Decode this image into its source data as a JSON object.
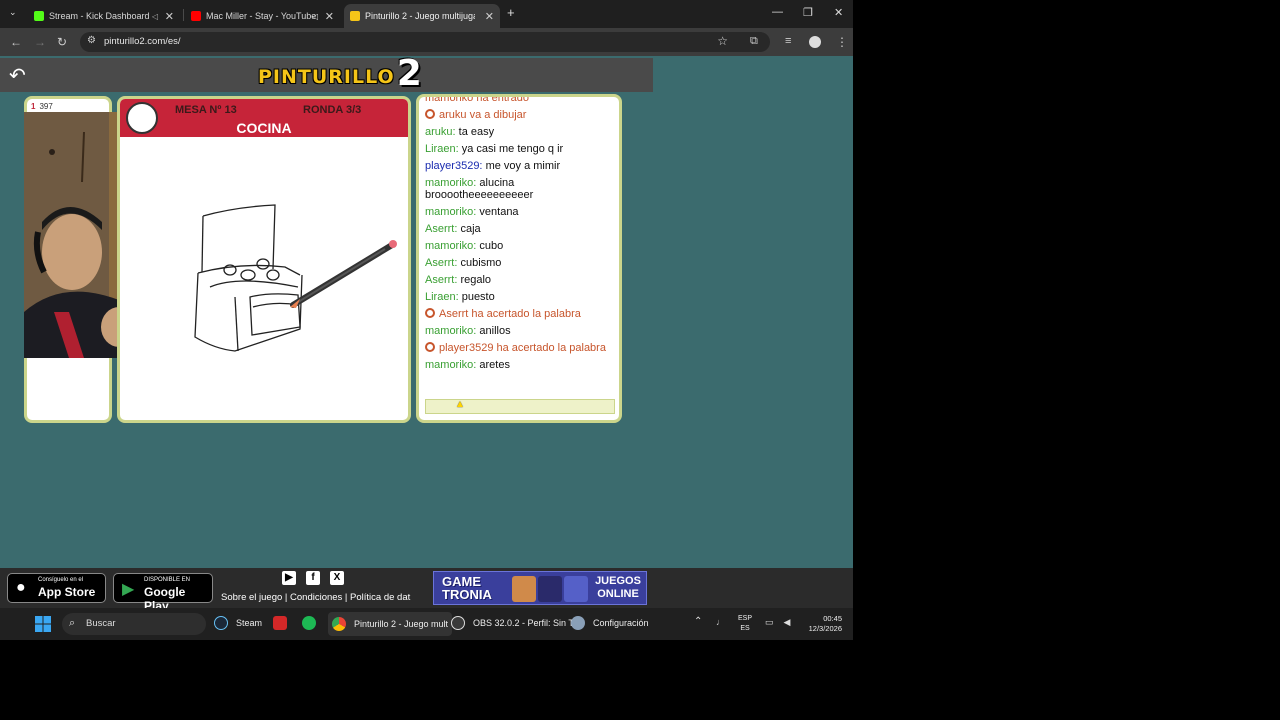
{
  "browser": {
    "tabs": [
      {
        "title": "Stream - Kick Dashboard",
        "favicon_color": "#53fc18",
        "active": false
      },
      {
        "title": "Mac Miller - Stay - YouTube",
        "favicon_color": "#ff0000",
        "active": false
      },
      {
        "title": "Pinturillo 2 - Juego multijugad",
        "favicon_color": "#f5c518",
        "active": true
      }
    ],
    "new_tab": "+",
    "url": "pinturillo2.com/es/"
  },
  "game": {
    "logo_text": "PINTURILLO",
    "logo_number": "2",
    "player_score": "397",
    "player_rank": "1",
    "mesa": "MESA Nº 13",
    "ronda": "RONDA 3/3",
    "word": "COCINA",
    "chat": [
      {
        "type": "system",
        "text": "mamoriko ha entrado"
      },
      {
        "type": "system",
        "text": "aruku va a dibujar"
      },
      {
        "type": "user",
        "user": "aruku:",
        "text": "ta easy"
      },
      {
        "type": "user",
        "user": "Liraen:",
        "text": "ya casi me tengo q ir"
      },
      {
        "type": "user",
        "user": "player3529:",
        "text": "me voy a mimir",
        "blue": true
      },
      {
        "type": "user",
        "user": "mamoriko:",
        "text": "alucina broooothееееееееeer"
      },
      {
        "type": "user",
        "user": "mamoriko:",
        "text": "ventana"
      },
      {
        "type": "user",
        "user": "Aserrt:",
        "text": "caja"
      },
      {
        "type": "user",
        "user": "mamoriko:",
        "text": "cubo"
      },
      {
        "type": "user",
        "user": "Aserrt:",
        "text": "cubismo"
      },
      {
        "type": "user",
        "user": "Aserrt:",
        "text": "regalo"
      },
      {
        "type": "user",
        "user": "Liraen:",
        "text": "puesto"
      },
      {
        "type": "system",
        "text": "Aserrt ha acertado la palabra"
      },
      {
        "type": "user",
        "user": "mamoriko:",
        "text": "anillos"
      },
      {
        "type": "system",
        "text": "player3529 ha acertado la palabra"
      },
      {
        "type": "user",
        "user": "mamoriko:",
        "text": "aretes"
      }
    ]
  },
  "footer": {
    "appstore_small": "Consíguelo en el",
    "appstore_big": "App Store",
    "googleplay_small": "DISPONIBLE EN",
    "googleplay_big": "Google Play",
    "links": "Sobre el juego | Condiciones | Política de dat",
    "gametronia_left": "GAME TRONIA",
    "gametronia_right": "JUEGOS ONLINE"
  },
  "taskbar": {
    "search": "Buscar",
    "items": [
      {
        "label": "Steam"
      },
      {
        "label": ""
      },
      {
        "label": ""
      },
      {
        "label": "Pinturillo 2 - Juego mult"
      },
      {
        "label": "OBS 32.0.2 - Perfil: Sin T"
      },
      {
        "label": "Configuración"
      }
    ],
    "lang_top": "ESP",
    "lang_bottom": "ES",
    "time": "00:45",
    "date": "12/3/2026"
  }
}
